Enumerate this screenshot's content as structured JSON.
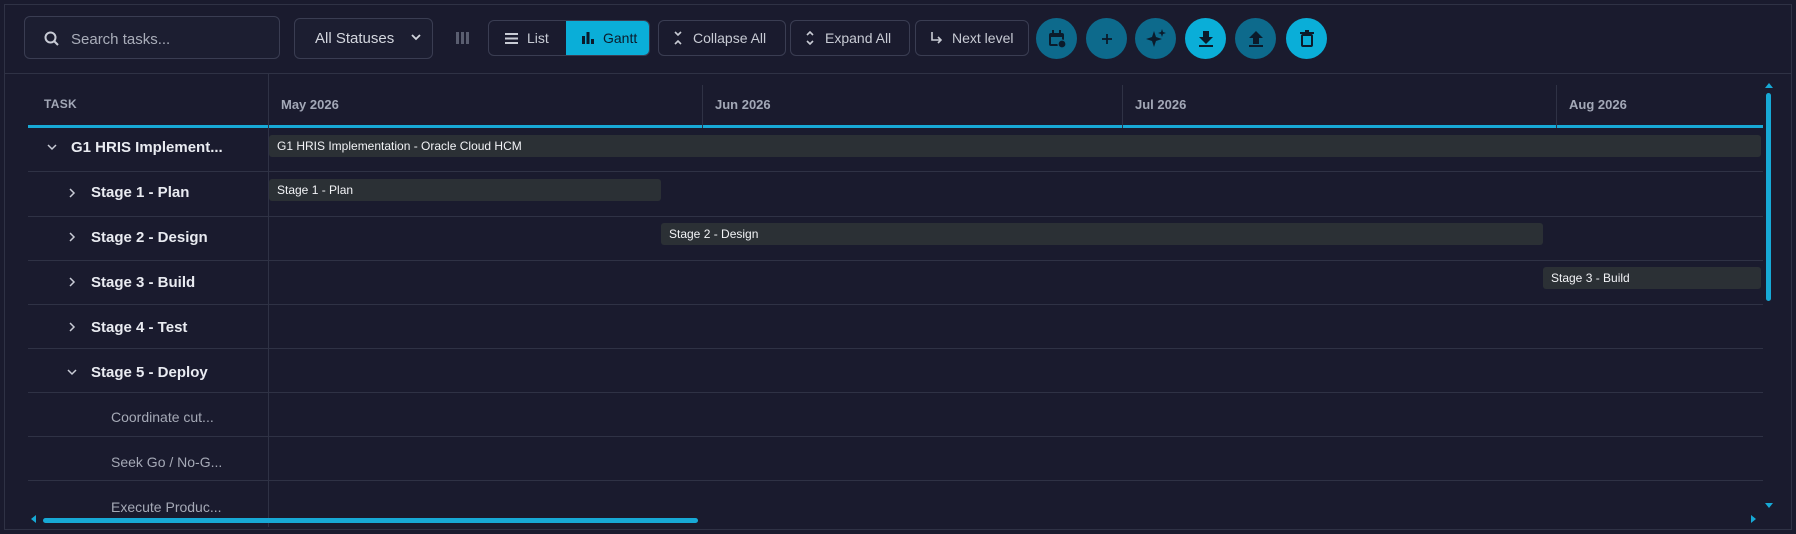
{
  "toolbar": {
    "search_placeholder": "Search tasks...",
    "status_filter": "All Statuses",
    "view_list": "List",
    "view_gantt": "Gantt",
    "collapse_all": "Collapse All",
    "expand_all": "Expand All",
    "next_level": "Next level"
  },
  "grid": {
    "task_header": "TASK",
    "months": [
      "May 2026",
      "Jun 2026",
      "Jul 2026",
      "Aug 2026"
    ]
  },
  "tasks": [
    {
      "name": "G1 HRIS Implement...",
      "level": 0,
      "expanded": true
    },
    {
      "name": "Stage 1 - Plan",
      "level": 1,
      "expanded": false
    },
    {
      "name": "Stage 2 - Design",
      "level": 1,
      "expanded": false
    },
    {
      "name": "Stage 3 - Build",
      "level": 1,
      "expanded": false
    },
    {
      "name": "Stage 4 - Test",
      "level": 1,
      "expanded": false
    },
    {
      "name": "Stage 5 - Deploy",
      "level": 1,
      "expanded": true
    },
    {
      "name": "Coordinate cut...",
      "level": 2
    },
    {
      "name": "Seek Go / No-G...",
      "level": 2
    },
    {
      "name": "Execute Produc...",
      "level": 2
    }
  ],
  "bars": [
    {
      "label": "G1 HRIS Implementation - Oracle Cloud HCM"
    },
    {
      "label": "Stage 1 - Plan"
    },
    {
      "label": "Stage 2 - Design"
    },
    {
      "label": "Stage 3 - Build"
    }
  ],
  "icons": {
    "search": "search-icon",
    "columns": "columns-icon",
    "calendar": "calendar-icon",
    "add": "plus-icon",
    "ai": "sparkle-icon",
    "download": "download-icon",
    "upload": "upload-icon",
    "delete": "trash-icon"
  },
  "colors": {
    "accent": "#0aaed8",
    "background": "#1a1b2e",
    "bar": "#2b3035"
  }
}
